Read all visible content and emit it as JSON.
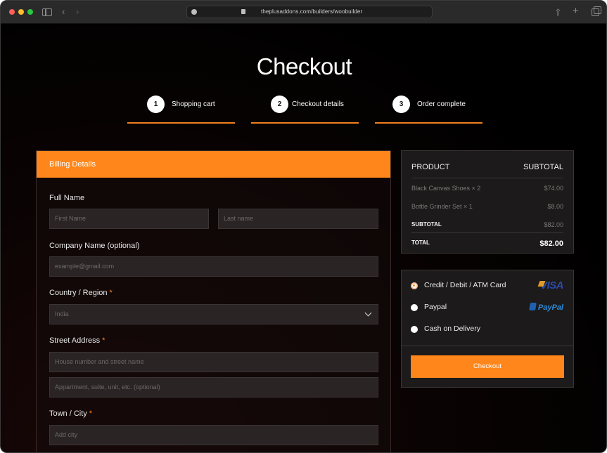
{
  "browser": {
    "url": "theplusaddons.com/builders/woobuilder"
  },
  "page": {
    "title": "Checkout"
  },
  "steps": [
    {
      "num": "1",
      "label": "Shopping cart"
    },
    {
      "num": "2",
      "label": "Checkout details"
    },
    {
      "num": "3",
      "label": "Order complete"
    }
  ],
  "billing": {
    "heading": "Billing Details",
    "full_name_label": "Full Name",
    "first_name_placeholder": "First Name",
    "last_name_placeholder": "Last name",
    "company_label": "Company Name (optional)",
    "company_placeholder": "example@gmail.com",
    "country_label": "Country / Region",
    "country_value": "India",
    "street_label": "Street Address",
    "street_placeholder_1": "House number and street name",
    "street_placeholder_2": "Appartment, suite, unit, etc. (optional)",
    "town_label": "Town / City",
    "town_placeholder": "Add city",
    "required_mark": "*"
  },
  "summary": {
    "product_header": "PRODUCT",
    "subtotal_header": "SUBTOTAL",
    "items": [
      {
        "name": "Black Canvas Shoes  × 2",
        "price": "$74.00"
      },
      {
        "name": "Bottle Grinder Set  × 1",
        "price": "$8.00"
      }
    ],
    "subtotal_label": "SUBTOTAL",
    "subtotal_value": "$82.00",
    "total_label": "TOTAL",
    "total_value": "$82.00"
  },
  "payment": {
    "options": [
      {
        "label": "Credit / Debit / ATM Card",
        "selected": true
      },
      {
        "label": "Paypal",
        "selected": false
      },
      {
        "label": "Cash on Delivery",
        "selected": false
      }
    ],
    "visa_logo": "VISA",
    "paypal_logo": "PayPal",
    "checkout_label": "Checkout"
  },
  "colors": {
    "accent": "#ff861a",
    "background": "#000000",
    "panel": "#1c1a1a"
  }
}
